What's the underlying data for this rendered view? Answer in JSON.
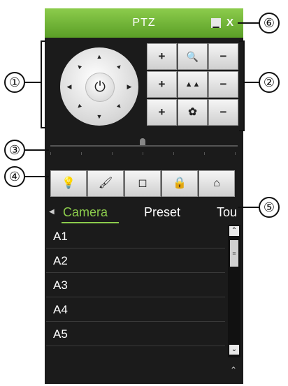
{
  "window": {
    "title": "PTZ",
    "minimize_icon": "▁",
    "close_icon": "X"
  },
  "directional": {
    "up": "▲",
    "down": "▼",
    "left": "◀",
    "right": "▶",
    "diag": "▲",
    "center_icon": "⏻"
  },
  "zoom_controls": {
    "rows": [
      {
        "name": "zoom",
        "plus": "+",
        "icon": "🔍",
        "minus": "−"
      },
      {
        "name": "focus",
        "plus": "+",
        "icon": "▲▲",
        "minus": "−"
      },
      {
        "name": "iris",
        "plus": "+",
        "icon": "✿",
        "minus": "−"
      }
    ]
  },
  "function_bar": {
    "light": "💡",
    "wiper": "🖌",
    "zoom_area": "◻",
    "lock": "🔒",
    "home": "⌂"
  },
  "tabs": {
    "scroll_left": "◀",
    "camera": "Camera",
    "preset": "Preset",
    "tour": "Tour"
  },
  "list": {
    "items": [
      "A1",
      "A2",
      "A3",
      "A4",
      "A5"
    ]
  },
  "scrollbar": {
    "up": "⌃",
    "down": "⌄",
    "thumb": "≡"
  },
  "collapse": "⌃",
  "callouts": [
    "①",
    "②",
    "③",
    "④",
    "⑤",
    "⑥"
  ]
}
